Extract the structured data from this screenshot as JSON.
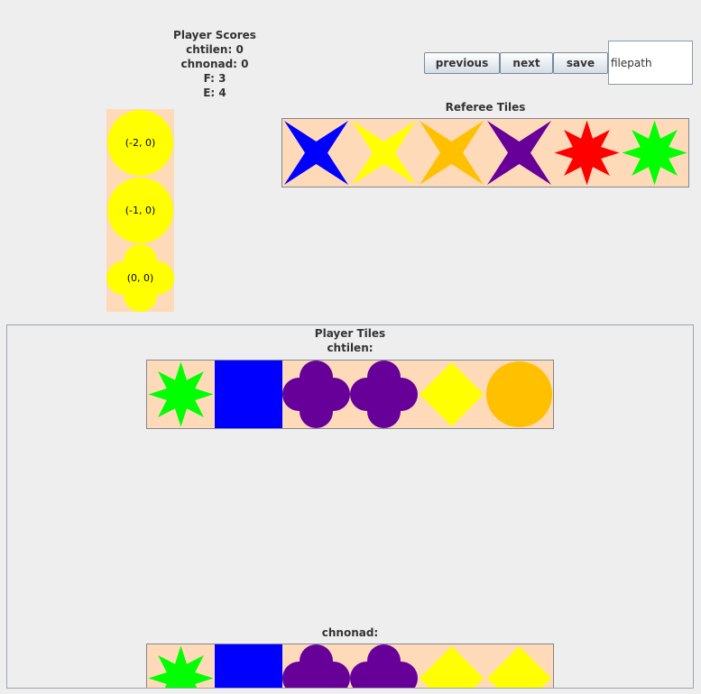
{
  "scores": {
    "title": "Player Scores",
    "lines": [
      "chtilen: 0",
      "chnonad: 0",
      "F: 3",
      "E: 4"
    ]
  },
  "toolbar": {
    "previous_label": "previous",
    "next_label": "next",
    "save_label": "save",
    "filepath_value": "filepath"
  },
  "board": {
    "tiles": [
      {
        "shape": "circle",
        "color": "#ffff00",
        "coord": "(-2, 0)"
      },
      {
        "shape": "circle",
        "color": "#ffff00",
        "coord": "(-1, 0)"
      },
      {
        "shape": "clover",
        "color": "#ffff00",
        "coord": "(0, 0)"
      }
    ]
  },
  "referee": {
    "title": "Referee Tiles",
    "tiles": [
      {
        "shape": "star4",
        "color": "#0000ff"
      },
      {
        "shape": "star4",
        "color": "#ffff00"
      },
      {
        "shape": "star4",
        "color": "#ffc000"
      },
      {
        "shape": "star4",
        "color": "#660099"
      },
      {
        "shape": "star8",
        "color": "#ff0000"
      },
      {
        "shape": "star8",
        "color": "#00ff00"
      }
    ]
  },
  "players": {
    "title": "Player Tiles",
    "list": [
      {
        "name": "chtilen:",
        "tiles": [
          {
            "shape": "star8",
            "color": "#00ff00"
          },
          {
            "shape": "square",
            "color": "#0000ff"
          },
          {
            "shape": "clover",
            "color": "#660099"
          },
          {
            "shape": "clover",
            "color": "#660099"
          },
          {
            "shape": "diamond",
            "color": "#ffff00"
          },
          {
            "shape": "circle",
            "color": "#ffc000"
          }
        ]
      },
      {
        "name": "chnonad:",
        "tiles": [
          {
            "shape": "star8",
            "color": "#00ff00"
          },
          {
            "shape": "square",
            "color": "#0000ff"
          },
          {
            "shape": "clover",
            "color": "#660099"
          },
          {
            "shape": "clover",
            "color": "#660099"
          },
          {
            "shape": "diamond",
            "color": "#ffff00"
          },
          {
            "shape": "diamond",
            "color": "#ffff00"
          }
        ]
      }
    ]
  }
}
